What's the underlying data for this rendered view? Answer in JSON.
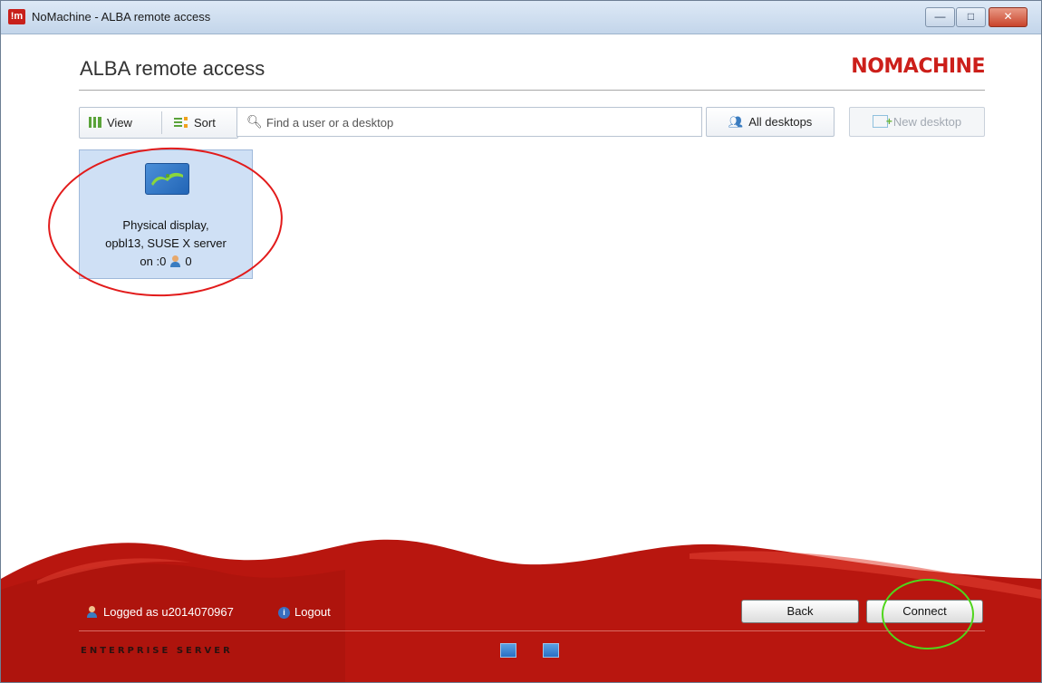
{
  "window": {
    "title": "NoMachine - ALBA remote access",
    "app_icon_text": "!m",
    "controls": {
      "minimize": "—",
      "maximize": "□",
      "close": "✕"
    }
  },
  "header": {
    "title": "ALBA remote access",
    "logo": "NOMACHINE"
  },
  "toolbar": {
    "view_label": "View",
    "sort_label": "Sort",
    "search_placeholder": "Find a user or a desktop",
    "all_desktops_label": "All desktops",
    "new_desktop_label": "New desktop"
  },
  "desktops": [
    {
      "line1": "Physical display,",
      "line2": "opbl13, SUSE X server",
      "line3_prefix": "on :0",
      "user_count": "0"
    }
  ],
  "footer": {
    "logged_as": "Logged as u2014070967",
    "logout_label": "Logout",
    "edition": "ENTERPRISE SERVER",
    "back_label": "Back",
    "connect_label": "Connect"
  },
  "colors": {
    "brand_red": "#c8201b",
    "tile_bg": "#cfe0f5",
    "annotation_red": "#e21b1b",
    "annotation_green": "#4fd61b"
  },
  "icons": [
    "app-icon",
    "grid-icon",
    "sort-icon",
    "search-icon",
    "users-icon",
    "new-desktop-icon",
    "monitor-icon",
    "user-icon",
    "logout-icon",
    "fullscreen-icon",
    "window-icon"
  ]
}
